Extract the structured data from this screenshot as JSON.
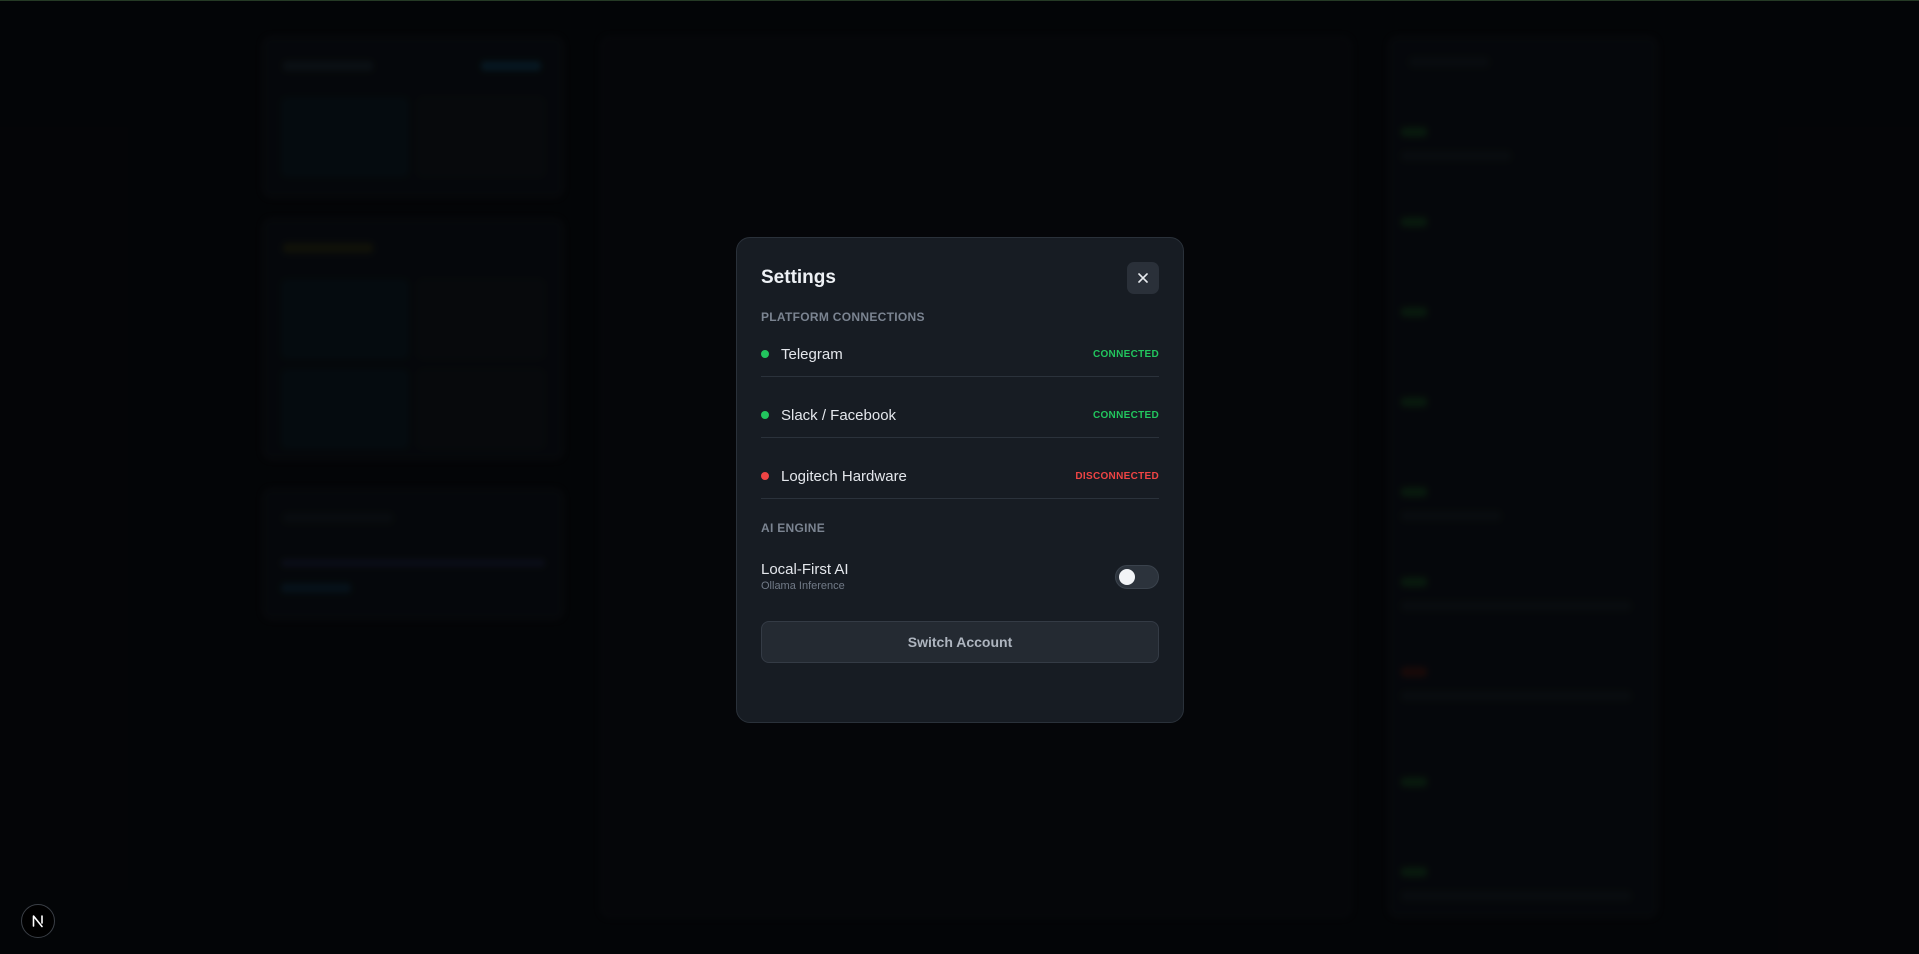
{
  "modal": {
    "title": "Settings",
    "close_icon": "close-icon",
    "platform_section_label": "PLATFORM CONNECTIONS",
    "connections": [
      {
        "name": "Telegram",
        "status": "CONNECTED",
        "status_color": "#22c55e",
        "dot_color": "#22c55e"
      },
      {
        "name": "Slack / Facebook",
        "status": "CONNECTED",
        "status_color": "#22c55e",
        "dot_color": "#22c55e"
      },
      {
        "name": "Logitech Hardware",
        "status": "DISCONNECTED",
        "status_color": "#ef4444",
        "dot_color": "#ef4444"
      }
    ],
    "ai_section_label": "AI ENGINE",
    "ai_setting": {
      "name": "Local-First AI",
      "subtitle": "Ollama Inference",
      "enabled": false
    },
    "switch_account_label": "Switch Account"
  },
  "dev_badge": {
    "label": "N",
    "icon": "nextjs-icon"
  },
  "colors": {
    "background": "#06080b",
    "modal_bg": "#171c23",
    "connected": "#22c55e",
    "disconnected": "#ef4444"
  }
}
